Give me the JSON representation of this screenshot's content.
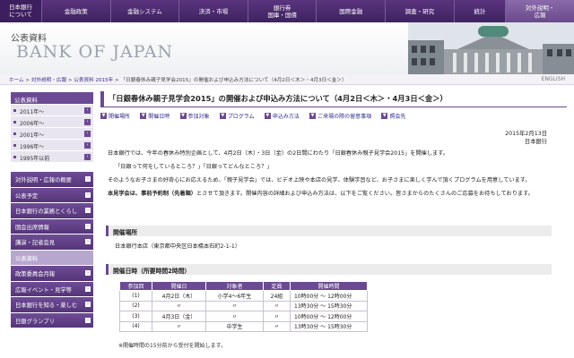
{
  "nav": {
    "logo_line1": "日本銀行",
    "logo_line2": "について",
    "items": [
      {
        "l1": "金融政策",
        "l2": ""
      },
      {
        "l1": "金融システム",
        "l2": ""
      },
      {
        "l1": "決済・市場",
        "l2": ""
      },
      {
        "l1": "銀行券",
        "l2": "国庫・国債"
      },
      {
        "l1": "国際金融",
        "l2": ""
      },
      {
        "l1": "調査・研究",
        "l2": ""
      },
      {
        "l1": "統計",
        "l2": ""
      },
      {
        "l1": "対外説明・",
        "l2": "広報"
      }
    ]
  },
  "header": {
    "section_title": "公表資料",
    "brand": "BANK OF JAPAN"
  },
  "breadcrumb": {
    "items": [
      "ホーム",
      "対外説明・広報",
      "公表資料 2015年",
      "「日銀春休み親子見学会2015」の開催および申込み方法について（4月2日＜木＞・4月3日＜金＞）"
    ],
    "english": "ENGLISH"
  },
  "sidebar": {
    "archive_header": "公表資料",
    "archive_items": [
      "2011年～",
      "2006年～",
      "2001年～",
      "1996年～",
      "1995年以前"
    ],
    "menu": [
      "対外説明・広報の概要",
      "公表予定",
      "日本銀行の業務とくらし",
      "国会出席情報",
      "講演・記者会見",
      "公表資料",
      "政策委員会月報",
      "広報イベント・見学等",
      "日本銀行を知る・楽しむ",
      "日銀グランプリ"
    ],
    "current_index": 5
  },
  "main": {
    "title": "「日銀春休み親子見学会2015」の開催および申込み方法について（4月2日＜木＞・4月3日＜金＞）",
    "anchors": [
      "開催場所",
      "開催日時",
      "参加対象",
      "プログラム",
      "申込み方法",
      "ご来場の際の留意事項",
      "照会先"
    ],
    "date": "2015年2月13日",
    "issuer": "日本銀行",
    "intro1": "日本銀行では、今年の春休み特別企画として、4月2日（木）・3日（金）の2日間にわたり「日銀春休み親子見学会2015」を開催します。",
    "intro2": "「日銀って何をしているところ？」「日銀ってどんなところ？」",
    "intro3": "そのようなお子さまの好奇心にお応えるため、「親子見学会」では、ビデオ上映や本店の見学、体験学習など、お子さまに楽しく学んで頂くプログラムを用意しています。",
    "intro4_bold": "本見学会は、事前予約制（先着順）",
    "intro4_rest": "とさせて頂きます。開催内容の詳細および申込み方法は、以下をご覧ください。皆さまからのたくさんのご応募をお待ちしております。",
    "venue_heading": "開催場所",
    "venue_text": "日本銀行本店（東京都中央区日本橋本石町2-1-1）",
    "dates_heading": "開催日時（所要時間2時間）",
    "table": {
      "headers": [
        "参加回",
        "開催日",
        "対象者",
        "定員",
        "開催時間"
      ],
      "rows": [
        [
          "(1)",
          "4月2日（木）",
          "小学4～6年生",
          "24組",
          "10時00分 ～ 12時00分"
        ],
        [
          "(2)",
          "〃",
          "〃",
          "〃",
          "13時30分 ～ 15時30分"
        ],
        [
          "(3)",
          "4月3日（金）",
          "〃",
          "〃",
          "10時00分 ～ 12時00分"
        ],
        [
          "(4)",
          "〃",
          "中学生",
          "〃",
          "13時30分 ～ 15時30分"
        ]
      ]
    },
    "note": "※開催時間の15分前から受付を開始します。"
  },
  "colors": {
    "brand_purple": "#6b4a93",
    "nav_dark": "#3d1f5f",
    "nav_active": "#7a5a9c"
  }
}
